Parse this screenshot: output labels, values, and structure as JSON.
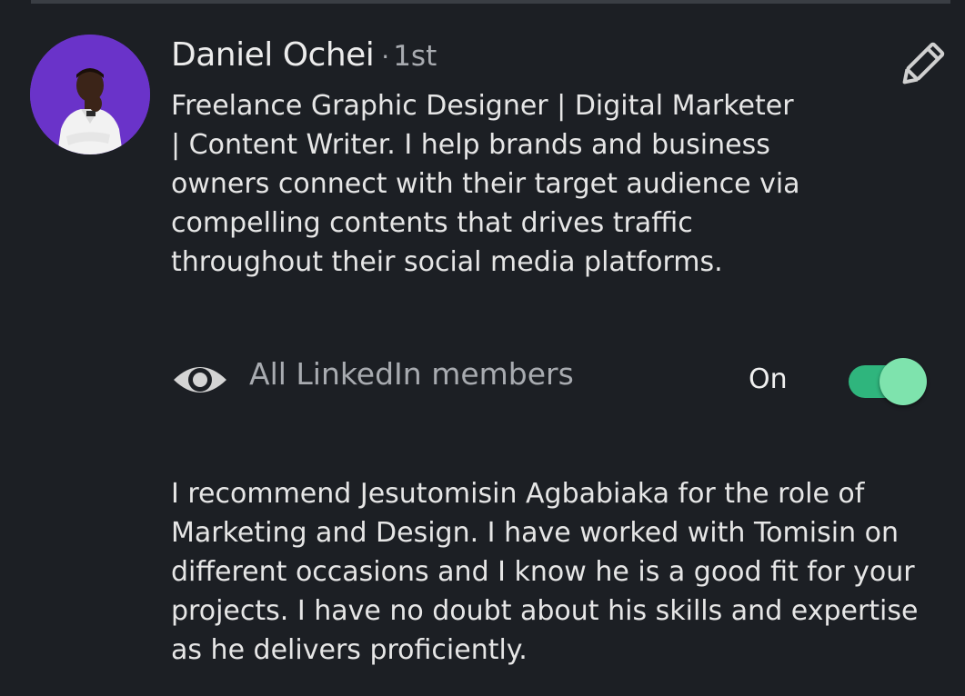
{
  "recommender": {
    "name": "Daniel Ochei",
    "separator": "·",
    "connection_degree": "1st",
    "headline": "Freelance Graphic Designer | Digital Marketer | Content Writer. I help brands and business owners connect with their target audience via compelling contents that drives traffic throughout their social media platforms.",
    "avatar_bg": "#6a33c9"
  },
  "visibility": {
    "icon": "eye-icon",
    "label": "All LinkedIn members",
    "toggle_label": "On",
    "toggle_on": true,
    "toggle_color": "#2fb57d"
  },
  "actions": {
    "edit_icon": "pencil-icon"
  },
  "recommendation": {
    "text": "I recommend Jesutomisin Agbabiaka for the role of Marketing and Design. I have worked with Tomisin on different occasions and I know he is a good fit for your projects. I have no doubt about his skills and expertise as he delivers proficiently."
  }
}
